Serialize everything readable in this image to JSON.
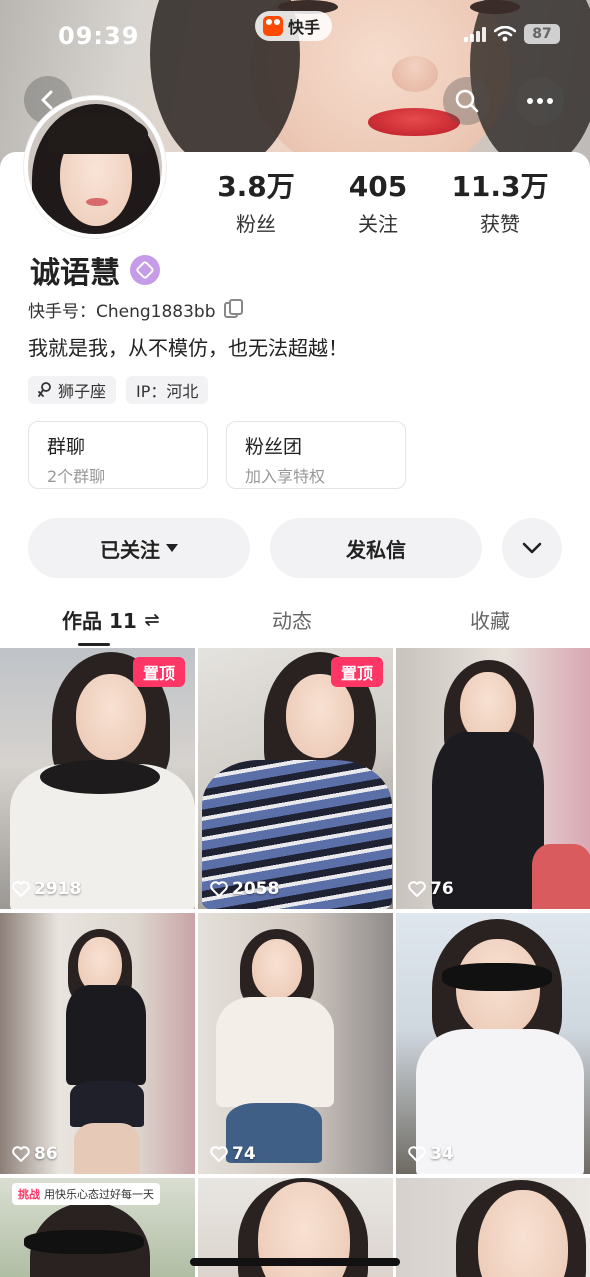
{
  "status_bar": {
    "time": "09:39",
    "app_name": "快手",
    "battery": "87"
  },
  "profile": {
    "name": "诚语慧",
    "ks_id": "快手号：Cheng1883bb",
    "bio": "我就是我，从不模仿，也无法超越！",
    "tags": [
      "狮子座",
      "IP：河北"
    ],
    "stats": [
      {
        "num": "3.8万",
        "label": "粉丝"
      },
      {
        "num": "405",
        "label": "关注"
      },
      {
        "num": "11.3万",
        "label": "获赞"
      }
    ]
  },
  "cards": [
    {
      "title": "群聊",
      "sub": "2个群聊"
    },
    {
      "title": "粉丝团",
      "sub": "加入享特权"
    }
  ],
  "actions": {
    "follow": "已关注",
    "message": "发私信"
  },
  "tabs": [
    {
      "label": "作品 11"
    },
    {
      "label": "动态"
    },
    {
      "label": "收藏"
    }
  ],
  "videos": [
    {
      "likes": "2918",
      "pinned": "置顶"
    },
    {
      "likes": "2058",
      "pinned": "置顶"
    },
    {
      "likes": "76"
    },
    {
      "likes": "86"
    },
    {
      "likes": "74"
    },
    {
      "likes": "34"
    }
  ],
  "challenge": {
    "tag": "挑战",
    "text": "用快乐心态过好每一天"
  },
  "colors": {
    "accent": "#fe3666",
    "brand": "#ff4906",
    "verify": "#c59ce8"
  },
  "icons": [
    "back-icon",
    "search-icon",
    "more-icon",
    "verified-icon",
    "copy-icon",
    "zodiac-icon",
    "caret-down-icon",
    "chevron-down-icon",
    "swap-icon",
    "heart-icon"
  ]
}
